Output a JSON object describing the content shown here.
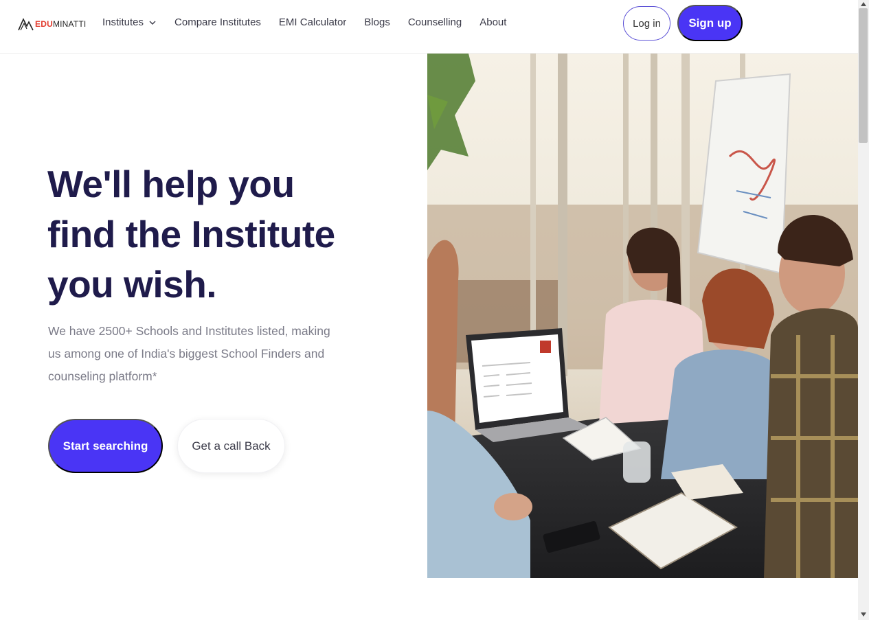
{
  "header": {
    "logo": {
      "edu": "EDU",
      "rest": "MINATTI"
    },
    "nav": [
      {
        "label": "Institutes",
        "has_dropdown": true
      },
      {
        "label": "Compare Institutes"
      },
      {
        "label": "EMI Calculator"
      },
      {
        "label": "Blogs"
      },
      {
        "label": "Counselling"
      },
      {
        "label": "About"
      }
    ],
    "login_label": "Log in",
    "signup_label": "Sign up"
  },
  "hero": {
    "title": "We'll help you find the Institute you wish.",
    "subtitle": "We have 2500+ Schools and Institutes listed, making us among one of India's biggest School Finders and counseling platform*",
    "primary_cta": "Start searching",
    "secondary_cta": "Get a call Back"
  },
  "colors": {
    "brand": "#4a35f5",
    "heading": "#1f1b4b",
    "logo_accent": "#e23b2e"
  },
  "icons": [
    "logo-mark-icon",
    "chevron-down-icon",
    "scroll-up-icon",
    "scroll-down-icon"
  ]
}
